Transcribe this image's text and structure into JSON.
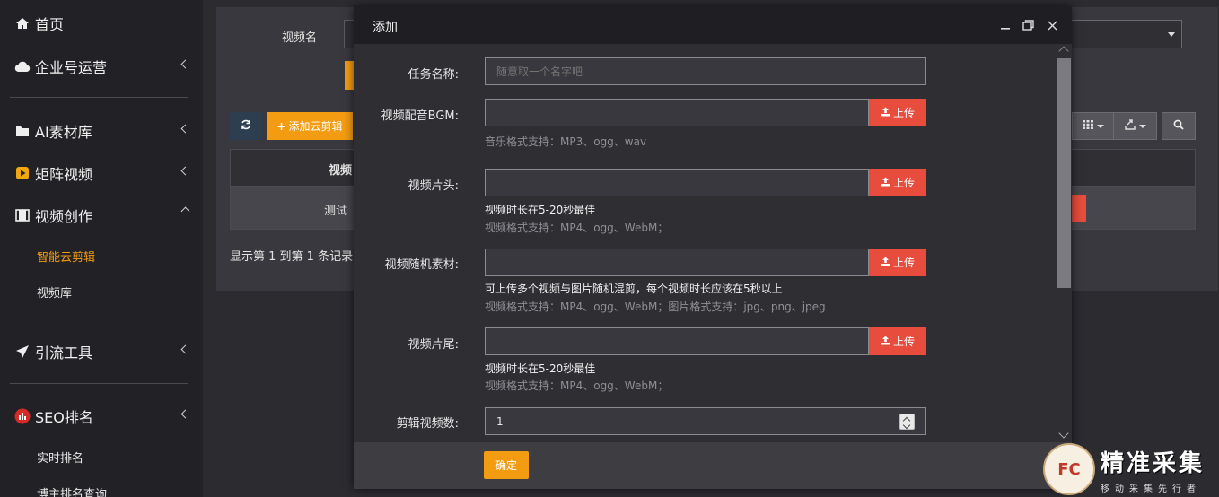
{
  "sidebar": {
    "items": [
      {
        "label": "首页",
        "icon": "home-icon"
      },
      {
        "label": "企业号运营",
        "icon": "cloud-icon"
      },
      {
        "label": "AI素材库",
        "icon": "folder-icon"
      },
      {
        "label": "矩阵视频",
        "icon": "play-icon"
      },
      {
        "label": "视频创作",
        "icon": "film-icon"
      },
      {
        "label": "引流工具",
        "icon": "paper-plane-icon"
      },
      {
        "label": "SEO排名",
        "icon": "bar-chart-icon"
      }
    ],
    "sub_items": {
      "video_creation": [
        "智能云剪辑",
        "视频库"
      ],
      "seo": [
        "实时排名",
        "博主排名查询"
      ]
    },
    "active_color": "#f39c12"
  },
  "background_page": {
    "filter_label": "视频名",
    "add_button": "添加云剪辑",
    "table_header_partial": "视频",
    "row_partial": "测试",
    "pagination_text": "显示第 1 到第 1 条记录，"
  },
  "modal": {
    "title": "添加",
    "fields": {
      "task_name": {
        "label": "任务名称:",
        "placeholder": "随意取一个名字吧"
      },
      "bgm": {
        "label": "视频配音BGM:",
        "hint": "音乐格式支持：MP3、ogg、wav"
      },
      "intro": {
        "label": "视频片头:",
        "hint_strong": "视频时长在5-20秒最佳",
        "hint": "视频格式支持：MP4、ogg、WebM；"
      },
      "random": {
        "label": "视频随机素材:",
        "hint_strong": "可上传多个视频与图片随机混剪，每个视频时长应该在5秒以上",
        "hint": "视频格式支持：MP4、ogg、WebM；图片格式支持：jpg、png、jpeg"
      },
      "outro": {
        "label": "视频片尾:",
        "hint_strong": "视频时长在5-20秒最佳",
        "hint": "视频格式支持：MP4、ogg、WebM；"
      },
      "count": {
        "label": "剪辑视频数:",
        "value": "1"
      }
    },
    "upload_label": "上传",
    "confirm_label": "确定"
  },
  "watermark": {
    "seal": "FC",
    "title": "精准采集",
    "subtitle": "移动采集先行者"
  },
  "colors": {
    "accent": "#f39c12",
    "danger": "#e74c3c"
  }
}
